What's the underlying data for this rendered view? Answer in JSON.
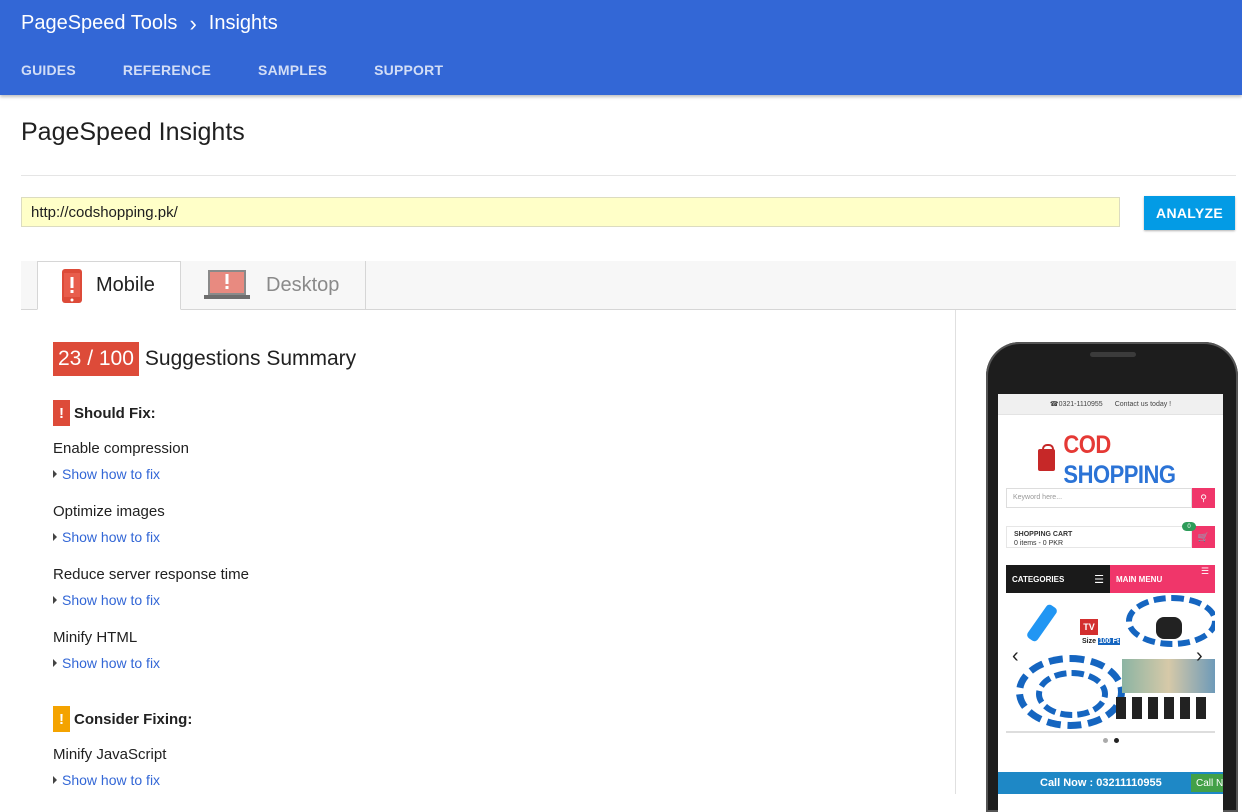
{
  "header": {
    "product": "PageSpeed Tools",
    "current": "Insights",
    "nav": [
      "GUIDES",
      "REFERENCE",
      "SAMPLES",
      "SUPPORT"
    ]
  },
  "page": {
    "title": "PageSpeed Insights"
  },
  "form": {
    "url_value": "http://codshopping.pk/",
    "analyze_label": "ANALYZE"
  },
  "tabs": [
    {
      "label": "Mobile",
      "active": true
    },
    {
      "label": "Desktop",
      "active": false
    }
  ],
  "summary": {
    "score": "23 / 100",
    "title": "Suggestions Summary"
  },
  "should_fix": {
    "heading": "Should Fix:",
    "items": [
      "Enable compression",
      "Optimize images",
      "Reduce server response time",
      "Minify HTML"
    ]
  },
  "consider_fixing": {
    "heading": "Consider Fixing:",
    "items": [
      "Minify JavaScript"
    ]
  },
  "fix_link_label": "Show how to fix",
  "preview": {
    "phone_number": "☎0321-1110955",
    "contact": "Contact us today !",
    "brand_prefix": "COD",
    "brand_suffix": " SHOPPING",
    "search_placeholder": "Keyword here...",
    "cart_title": "SHOPPING CART",
    "cart_summary": "0 items - 0 PKR",
    "cart_count": "0",
    "categories": "CATEGORIES",
    "main_menu": "MAIN MENU",
    "call_now": "Call Now : 03211110955",
    "call_short": "Call N",
    "banner_size": "Size",
    "banner_ft": "100 Ft"
  },
  "colors": {
    "topbar": "#3367d6",
    "score_badge": "#dd4b39",
    "warning": "#f4a300",
    "analyze": "#039be5"
  }
}
